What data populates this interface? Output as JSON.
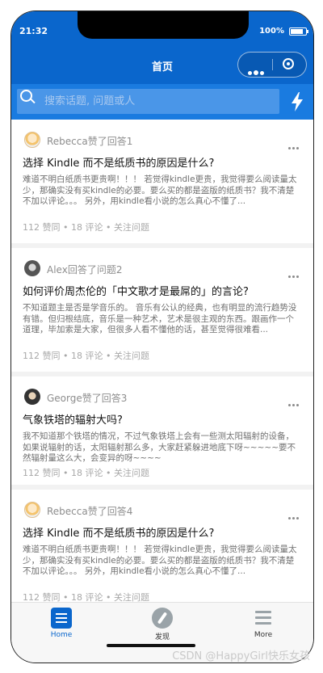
{
  "status_bar": {
    "time": "21:32",
    "battery": "100%"
  },
  "header": {
    "title": "首页"
  },
  "search": {
    "placeholder": "搜索话题, 问题或人"
  },
  "feed": [
    {
      "actor": "Rebecca赞了回答1",
      "title": "选择 Kindle 而不是纸质书的原因是什么?",
      "excerpt": "难道不明白纸质书更贵啊！！！ 若觉得kindle更贵，我觉得要么阅读量太少，那确实没有买kindle的必要。要么买的都是盗版的纸质书？我不清楚不加以评论。。。 另外，用kindle看小说的怎么真心不懂了...",
      "meta": "112 赞同 • 18 评论 • 关注问题"
    },
    {
      "actor": "Alex回答了问题2",
      "title": "如何评价周杰伦的「中文歌才是最屌的」的言论?",
      "excerpt": "不知道题主是否是学音乐的。 音乐有公认的经典，也有明显的流行趋势没有错。但归根结底，音乐是一种艺术，艺术是很主观的东西。跟画作一个道理，毕加索是大家，但很多人看不懂他的话，甚至觉得很难看...",
      "meta": "112 赞同 • 18 评论 • 关注问题"
    },
    {
      "actor": "George赞了回答3",
      "title": "气象铁塔的辐射大吗?",
      "excerpt": "我不知道那个铁塔的情况，不过气象铁塔上会有一些测太阳辐射的设备，如果说辐射的话，太阳辐射那么多，大家赶紧躲进地底下呀~~~~~要不然辐射量这么大，会变异的呀~~~~",
      "meta": "112 赞同 • 18 评论 • 关注问题"
    },
    {
      "actor": "Rebecca赞了回答4",
      "title": "选择 Kindle 而不是纸质书的原因是什么?",
      "excerpt": "难道不明白纸质书更贵啊！！！ 若觉得kindle更贵，我觉得要么阅读量太少，那确实没有买kindle的必要。要么买的都是盗版的纸质书？我不清楚不加以评论。。。 另外，用kindle看小说的怎么真心不懂了...",
      "meta": "112 赞同 • 18 评论 • 关注问题"
    }
  ],
  "tabs": [
    {
      "label": "Home",
      "icon": "home-icon"
    },
    {
      "label": "发现",
      "icon": "compass-icon"
    },
    {
      "label": "More",
      "icon": "menu-icon"
    }
  ],
  "watermark": "CSDN @HappyGirl快乐女孩",
  "colors": {
    "brand": "#0a66cc",
    "search_bg": "#1a7be0"
  }
}
